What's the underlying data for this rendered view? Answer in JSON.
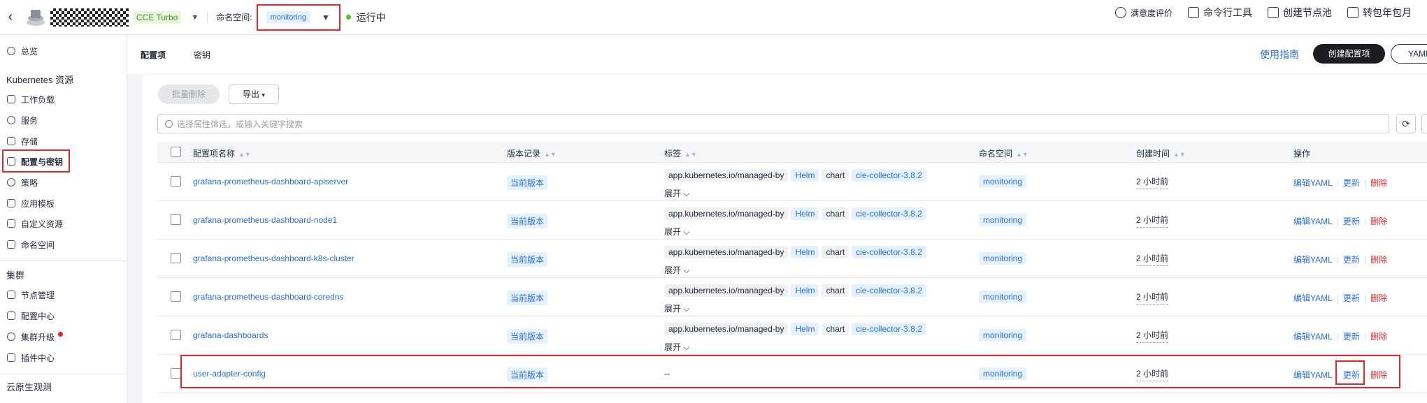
{
  "topbar": {
    "cluster_badge": "CCE Turbo",
    "namespace_label": "命名空间:",
    "namespace_value": "monitoring",
    "status_text": "运行中",
    "links": [
      {
        "label": "满意度评价",
        "icon": "smile-icon"
      },
      {
        "label": "命令行工具",
        "icon": "terminal-icon"
      },
      {
        "label": "创建节点池",
        "icon": "node-pool-icon"
      },
      {
        "label": "转包年包月",
        "icon": "calendar-icon"
      }
    ]
  },
  "sidebar": {
    "overview": "总览",
    "section_k8s": "Kubernetes 资源",
    "k8s_items": [
      "工作负载",
      "服务",
      "存储",
      "配置与密钥",
      "策略",
      "应用模板",
      "自定义资源",
      "命名空间"
    ],
    "section_cluster": "集群",
    "cluster_items": [
      "节点管理",
      "配置中心",
      "集群升级",
      "插件中心"
    ],
    "section_observe": "云原生观测"
  },
  "main": {
    "tabs": [
      "配置项",
      "密钥"
    ],
    "guide_link": "使用指南",
    "create_button": "创建配置项",
    "yaml_button": "YAML",
    "batch_delete": "批量删除",
    "export": "导出",
    "search_placeholder": "选择属性筛选，或输入关键字搜索",
    "columns": [
      "配置项名称",
      "版本记录",
      "标签",
      "命名空间",
      "创建时间",
      "操作"
    ],
    "expand_label": "展开",
    "ops": {
      "edit": "编辑YAML",
      "update": "更新",
      "delete": "删除"
    },
    "rows": [
      {
        "name": "grafana-prometheus-dashboard-apiserver",
        "version": "当前版本",
        "labels": [
          "app.kubernetes.io/managed-by",
          "Helm",
          "chart",
          "cie-collector-3.8.2"
        ],
        "namespace": "monitoring",
        "created": "2 小时前"
      },
      {
        "name": "grafana-prometheus-dashboard-node1",
        "version": "当前版本",
        "labels": [
          "app.kubernetes.io/managed-by",
          "Helm",
          "chart",
          "cie-collector-3.8.2"
        ],
        "namespace": "monitoring",
        "created": "2 小时前"
      },
      {
        "name": "grafana-prometheus-dashboard-k8s-cluster",
        "version": "当前版本",
        "labels": [
          "app.kubernetes.io/managed-by",
          "Helm",
          "chart",
          "cie-collector-3.8.2"
        ],
        "namespace": "monitoring",
        "created": "2 小时前"
      },
      {
        "name": "grafana-prometheus-dashboard-coredns",
        "version": "当前版本",
        "labels": [
          "app.kubernetes.io/managed-by",
          "Helm",
          "chart",
          "cie-collector-3.8.2"
        ],
        "namespace": "monitoring",
        "created": "2 小时前"
      },
      {
        "name": "grafana-dashboards",
        "version": "当前版本",
        "labels": [
          "app.kubernetes.io/managed-by",
          "Helm",
          "chart",
          "cie-collector-3.8.2"
        ],
        "namespace": "monitoring",
        "created": "2 小时前"
      },
      {
        "name": "user-adapter-config",
        "version": "当前版本",
        "labels_empty": "--",
        "namespace": "monitoring",
        "created": "2 小时前"
      }
    ]
  },
  "colors": {
    "accent": "#2a6fd6",
    "highlight": "#e0282e",
    "danger": "#e0282e",
    "running": "#52c41a"
  }
}
